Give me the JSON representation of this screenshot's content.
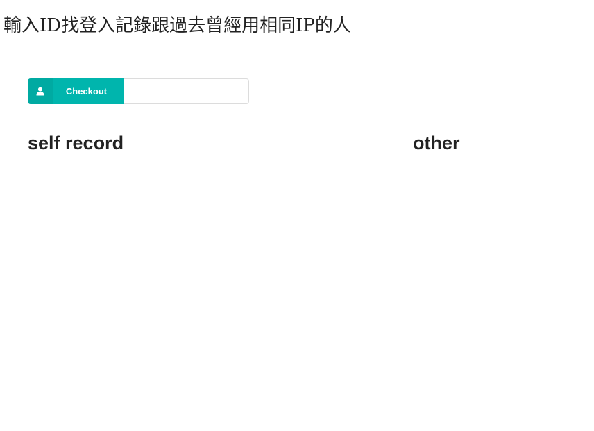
{
  "page": {
    "title": "輸入ID找登入記錄跟過去曾經用相同IP的人"
  },
  "search": {
    "button_label": "Checkout",
    "button_icon": "user-icon",
    "input_value": "",
    "input_placeholder": ""
  },
  "sections": {
    "self_title": "self record",
    "other_title": "other"
  },
  "colors": {
    "accent": "#00b5ad",
    "text": "#222222",
    "input_border": "#dcdcdc"
  }
}
